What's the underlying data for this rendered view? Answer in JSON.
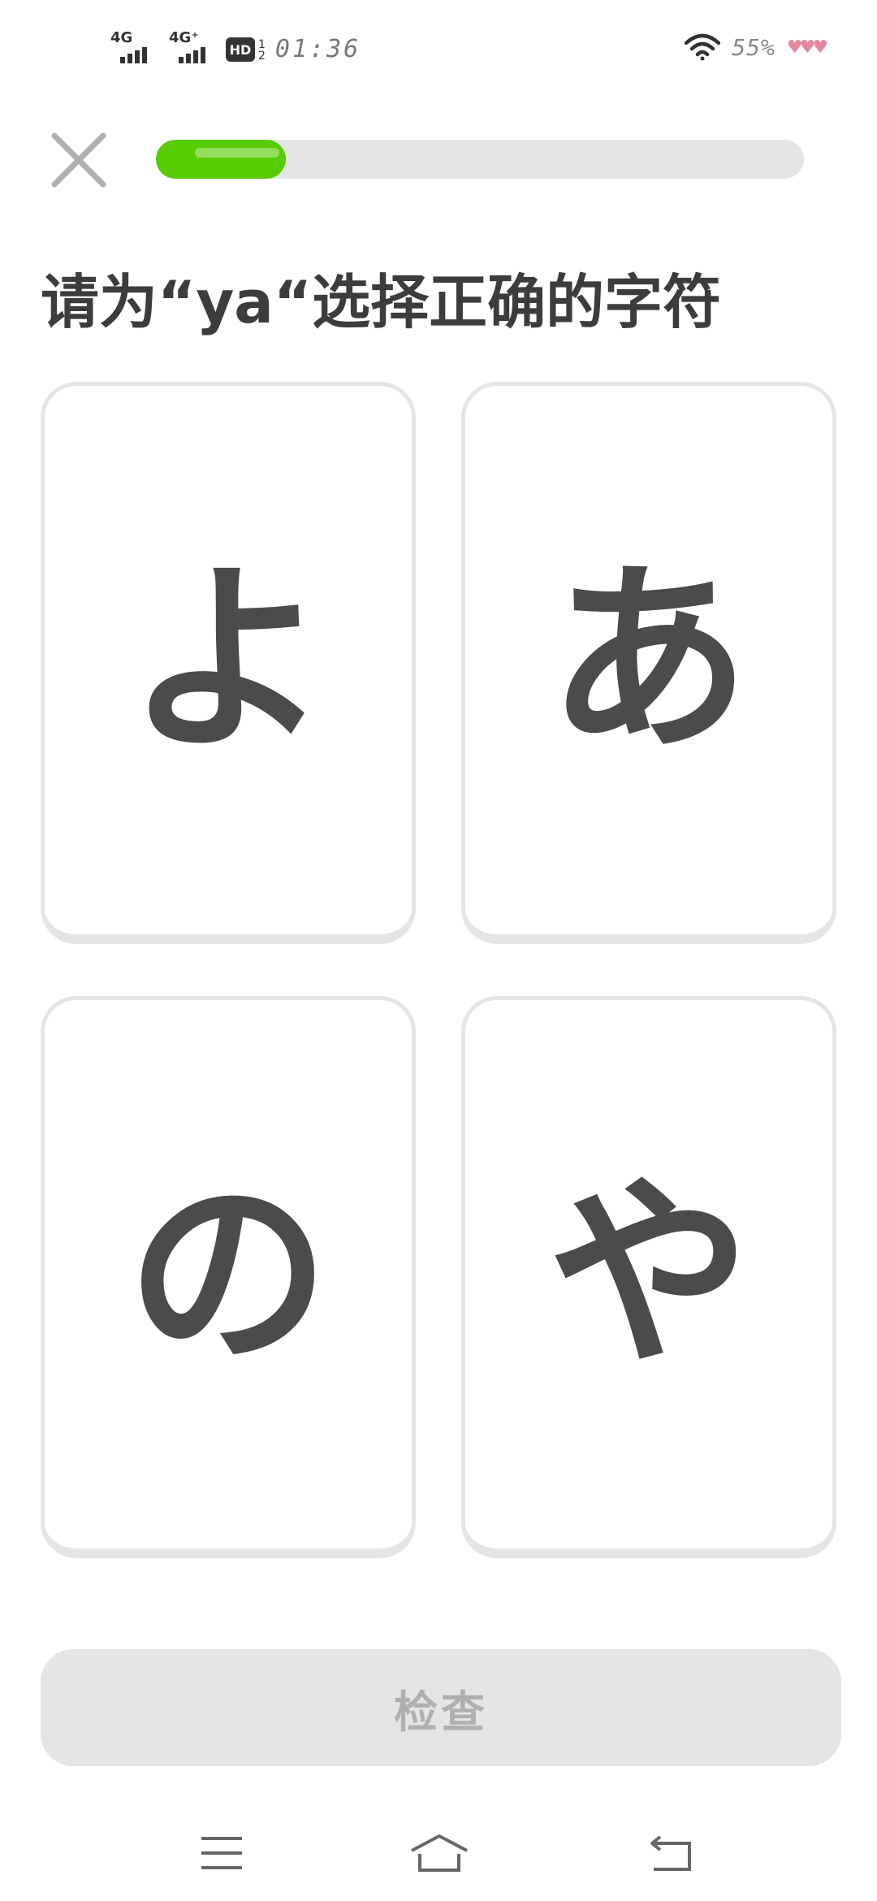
{
  "status_bar": {
    "network_1": "4G",
    "network_2": "4G⁺",
    "hd_label": "HD",
    "sim_top": "1",
    "sim_bottom": "2",
    "time": "01:36",
    "battery": "55%",
    "hearts": "♥♥♥"
  },
  "lesson": {
    "progress_fraction": 0.2,
    "prompt": "请为“ya“选择正确的字符",
    "choices": [
      {
        "char": "よ"
      },
      {
        "char": "あ"
      },
      {
        "char": "の"
      },
      {
        "char": "や"
      }
    ],
    "check_label": "检查"
  },
  "colors": {
    "progress": "#58cc02",
    "track": "#e5e5e5",
    "text": "#4b4b4b",
    "button_disabled": "#e5e5e5",
    "button_text_disabled": "#afafaf"
  },
  "icons": {
    "close": "close-icon",
    "menu": "menu-icon",
    "home": "home-icon",
    "back": "back-icon",
    "wifi": "wifi-icon"
  }
}
